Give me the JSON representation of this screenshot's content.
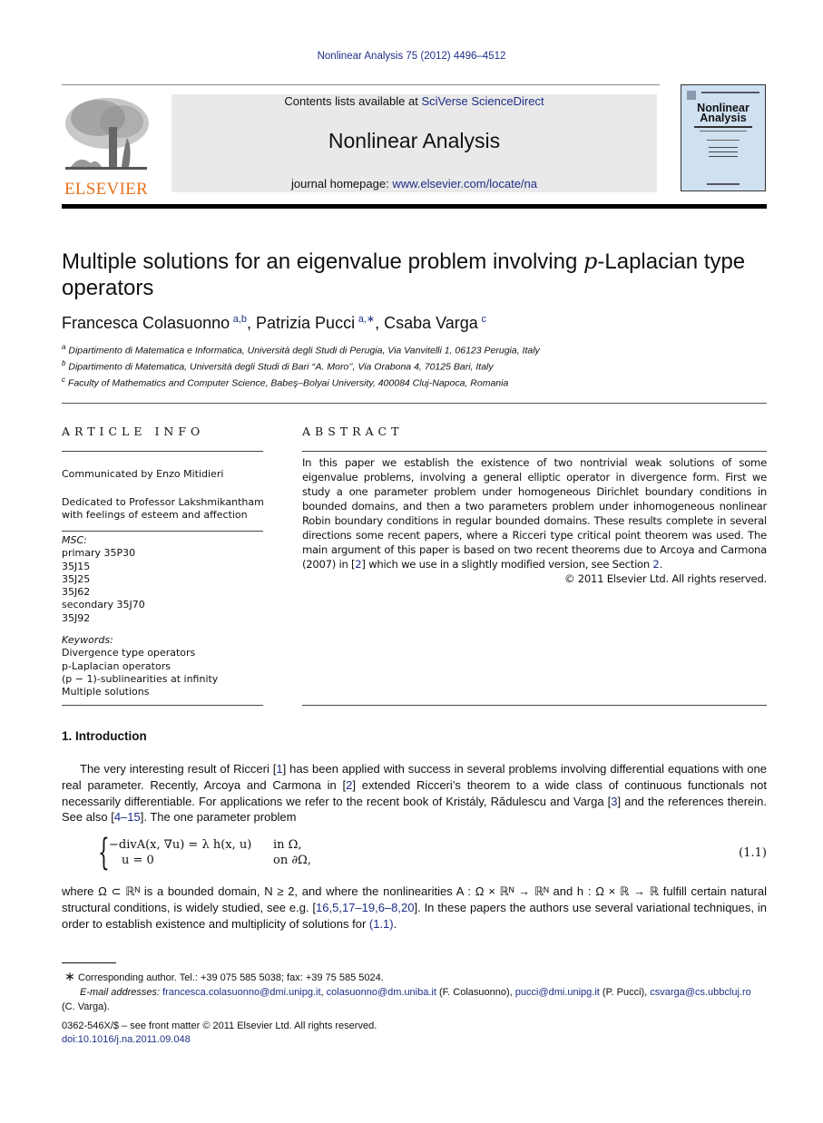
{
  "header": {
    "journal_ref": "Nonlinear Analysis 75 (2012) 4496–4512",
    "contents_prefix": "Contents lists available at ",
    "contents_link": "SciVerse ScienceDirect",
    "journal_name": "Nonlinear Analysis",
    "homepage_prefix": "journal homepage: ",
    "homepage_link": "www.elsevier.com/locate/na",
    "publisher_logo": "ELSEVIER",
    "cover_title_1": "Nonlinear",
    "cover_title_2": "Analysis",
    "colors": {
      "link": "#1f2e86",
      "elsevier_orange": "#e9711c",
      "masthead_bg": "#e9e9e9",
      "cover_bg": "#cfe0f0"
    }
  },
  "article": {
    "title": "Multiple solutions for an eigenvalue problem involving p-Laplacian type operators",
    "title_part1": "Multiple solutions for an eigenvalue problem involving ",
    "title_italic": "p",
    "title_part2": "-Laplacian type operators",
    "authors": [
      {
        "name": "Francesca Colasuonno",
        "marks": "a,b"
      },
      {
        "name": "Patrizia Pucci",
        "marks": "a,∗"
      },
      {
        "name": "Csaba Varga",
        "marks": "c"
      }
    ],
    "affiliations": [
      {
        "mark": "a",
        "text": "Dipartimento di Matematica e Informatica, Università degli Studi di Perugia, Via Vanvitelli 1, 06123 Perugia, Italy"
      },
      {
        "mark": "b",
        "text": "Dipartimento di Matematica, Università degli Studi di Bari ‘‘A. Moro’’, Via Orabona 4, 70125 Bari, Italy"
      },
      {
        "mark": "c",
        "text": "Faculty of Mathematics and Computer Science, Babeş–Bolyai University, 400084 Cluj-Napoca, Romania"
      }
    ]
  },
  "article_info": {
    "heading": "ARTICLE INFO",
    "communicated": "Communicated by Enzo Mitidieri",
    "dedication_1": "Dedicated to Professor Lakshmikantham",
    "dedication_2": "with feelings of esteem and affection",
    "msc_label": "MSC:",
    "msc": [
      "primary 35P30",
      "35J15",
      "35J25",
      "35J62",
      "secondary 35J70",
      "35J92"
    ],
    "keywords_label": "Keywords:",
    "keywords": [
      "Divergence type operators",
      "p-Laplacian operators",
      "(p − 1)-sublinearities at infinity",
      "Multiple solutions"
    ]
  },
  "abstract": {
    "heading": "ABSTRACT",
    "text_1": "In this paper we establish the existence of two nontrivial weak solutions of some eigenvalue problems, involving a general elliptic operator in divergence form. First we study a one parameter problem under homogeneous Dirichlet boundary conditions in bounded domains, and then a two parameters problem under inhomogeneous nonlinear Robin boundary conditions in regular bounded domains. These results complete in several directions some recent papers, where a Ricceri type critical point theorem was used. The main argument of this paper is based on two recent theorems due to Arcoya and Carmona (2007) in [",
    "ref_1": "2",
    "text_2": "] which we use in a slightly modified version, see Section ",
    "ref_2": "2",
    "text_3": ".",
    "copyright": "© 2011 Elsevier Ltd. All rights reserved."
  },
  "introduction": {
    "heading": "1.  Introduction",
    "p1": [
      {
        "t": "The very interesting result of Ricceri ["
      },
      {
        "l": "1"
      },
      {
        "t": "] has been applied with success in several problems involving differential equations with one real parameter. Recently, Arcoya and Carmona in ["
      },
      {
        "l": "2"
      },
      {
        "t": "] extended Ricceri’s theorem to a wide class of continuous functionals not necessarily differentiable. For applications we refer to the recent book of Kristály, Rădulescu and Varga ["
      },
      {
        "l": "3"
      },
      {
        "t": "] and the references therein. See also ["
      },
      {
        "l": "4–15"
      },
      {
        "t": "]. The one parameter problem"
      }
    ],
    "equation": {
      "line1_lhs": "−divA(x, ∇u) = λ h(x, u)",
      "line1_rhs": "in Ω,",
      "line2_lhs": "u = 0",
      "line2_rhs": "on ∂Ω,",
      "number": "(1.1)"
    },
    "p2": [
      {
        "t": "where Ω ⊂ ℝᴺ is a bounded domain, N ≥ 2, and where the nonlinearities A : Ω × ℝᴺ → ℝᴺ and h : Ω × ℝ → ℝ fulfill certain natural structural conditions, is widely studied, see e.g. ["
      },
      {
        "l": "16,5,17–19,6–8,20"
      },
      {
        "t": "]. In these papers the authors use several variational techniques, in order to establish existence and multiplicity of solutions for "
      },
      {
        "l": "(1.1)"
      },
      {
        "t": "."
      }
    ]
  },
  "footnotes": {
    "star": "∗",
    "corresponding": "Corresponding author. Tel.: +39 075 585 5038; fax: +39 75 585 5024.",
    "email_label": "E-mail addresses:",
    "email_1": "francesca.colasuonno@dmi.unipg.it",
    "email_2": "colasuonno@dm.uniba.it",
    "email_2_owner": " (F. Colasuonno), ",
    "email_3": "pucci@dmi.unipg.it",
    "email_3_owner": " (P. Pucci), ",
    "email_4": "csvarga@cs.ubbcluj.ro",
    "email_4_owner": "(C. Varga).",
    "front_matter": "0362-546X/$ – see front matter © 2011 Elsevier Ltd. All rights reserved.",
    "doi": "doi:10.1016/j.na.2011.09.048"
  }
}
